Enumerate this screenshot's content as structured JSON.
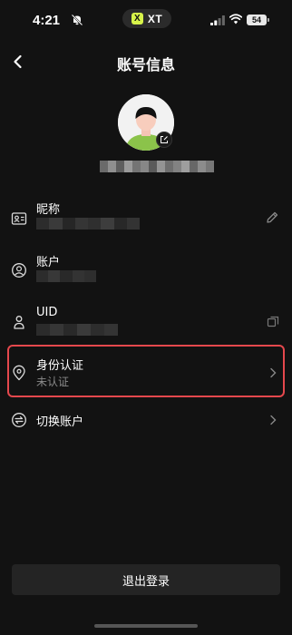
{
  "status_bar": {
    "time": "4:21",
    "app_pill_label": "XT",
    "app_pill_logo": "X",
    "battery": "54"
  },
  "header": {
    "title": "账号信息"
  },
  "rows": {
    "nickname": {
      "label": "昵称"
    },
    "account": {
      "label": "账户"
    },
    "uid": {
      "label": "UID"
    },
    "identity": {
      "label": "身份认证",
      "status": "未认证"
    },
    "switch_account": {
      "label": "切换账户"
    }
  },
  "logout": {
    "label": "退出登录"
  },
  "colors": {
    "background": "#121212",
    "highlight_border": "#e5484d",
    "avatar_shirt": "#8bc34a"
  }
}
